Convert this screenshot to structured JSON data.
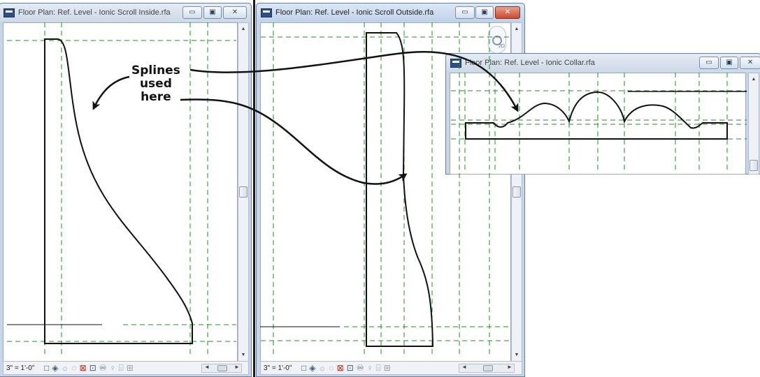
{
  "windows": {
    "inside": {
      "title": "Floor Plan: Ref. Level - Ionic Scroll Inside.rfa",
      "scale": "3\" = 1'-0\""
    },
    "outside": {
      "title": "Floor Plan: Ref. Level - Ionic Scroll Outside.rfa",
      "scale": "3\" = 1'-0\"",
      "nav_wheel_label": "2D"
    },
    "collar": {
      "title": "Floor Plan: Ref. Level - Ionic Collar.rfa"
    }
  },
  "titlebar_buttons": {
    "minimize": "▭",
    "maximize": "▣",
    "close": "✕"
  },
  "scrollbar": {
    "up": "▲",
    "down": "▼",
    "left": "◄",
    "right": "►"
  },
  "callout": {
    "line1": "Splines",
    "line2": "used",
    "line3": "here"
  },
  "status_icons": [
    "box-icon",
    "cube-icon",
    "sun-icon",
    "shadow-icon",
    "crop-icon",
    "crop-region-icon",
    "temp-hide-icon",
    "reveal-icon",
    "lightbulb-icon",
    "model-display-icon",
    "more-icon"
  ],
  "colors": {
    "ref_plane": "#1f8f1f",
    "close_button": "#c84b2f",
    "window_frame": "#c7d6ea"
  }
}
